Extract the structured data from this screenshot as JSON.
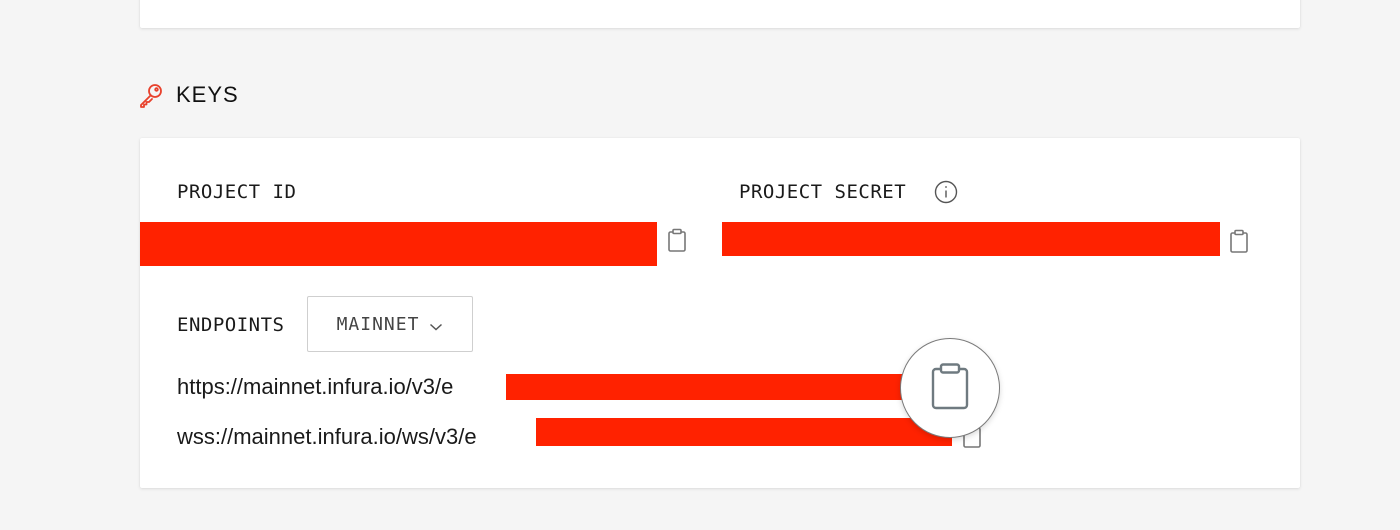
{
  "section": {
    "title": "KEYS",
    "icon": "key-icon",
    "accent_color": "#e8412c"
  },
  "project_id": {
    "label": "PROJECT ID",
    "value_redacted": true,
    "copy_icon": "clipboard-icon"
  },
  "project_secret": {
    "label": "PROJECT SECRET",
    "info_icon": "info-icon",
    "value_redacted": true,
    "copy_icon": "clipboard-icon"
  },
  "endpoints": {
    "label": "ENDPOINTS",
    "network_selected": "MAINNET",
    "urls": [
      {
        "prefix": "https://mainnet.infura.io/v3/e",
        "redacted_suffix": true
      },
      {
        "prefix": "wss://mainnet.infura.io/ws/v3/e",
        "redacted_suffix": true
      }
    ]
  },
  "colors": {
    "redaction": "#ff2200",
    "background": "#f5f5f5",
    "card": "#ffffff"
  }
}
